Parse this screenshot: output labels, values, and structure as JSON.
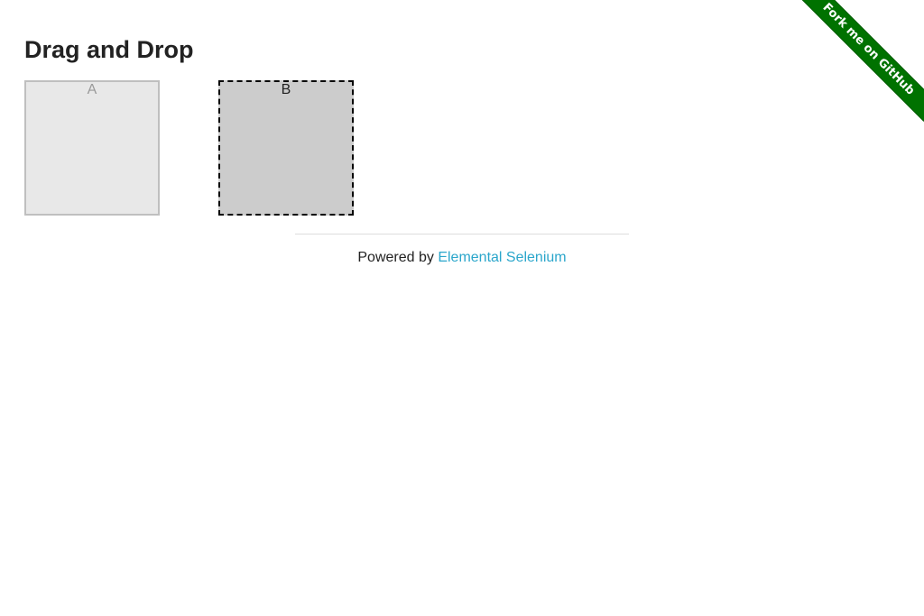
{
  "page": {
    "title": "Drag and Drop"
  },
  "columns": [
    {
      "header": "A"
    },
    {
      "header": "B"
    }
  ],
  "footer": {
    "prefix": "Powered by ",
    "link_text": "Elemental Selenium"
  },
  "ribbon": {
    "label": "Fork me on GitHub",
    "color": "#007200"
  },
  "colors": {
    "link": "#2ba6cb",
    "column_a_bg": "#e8e8e8",
    "column_b_bg": "#cccccc"
  }
}
